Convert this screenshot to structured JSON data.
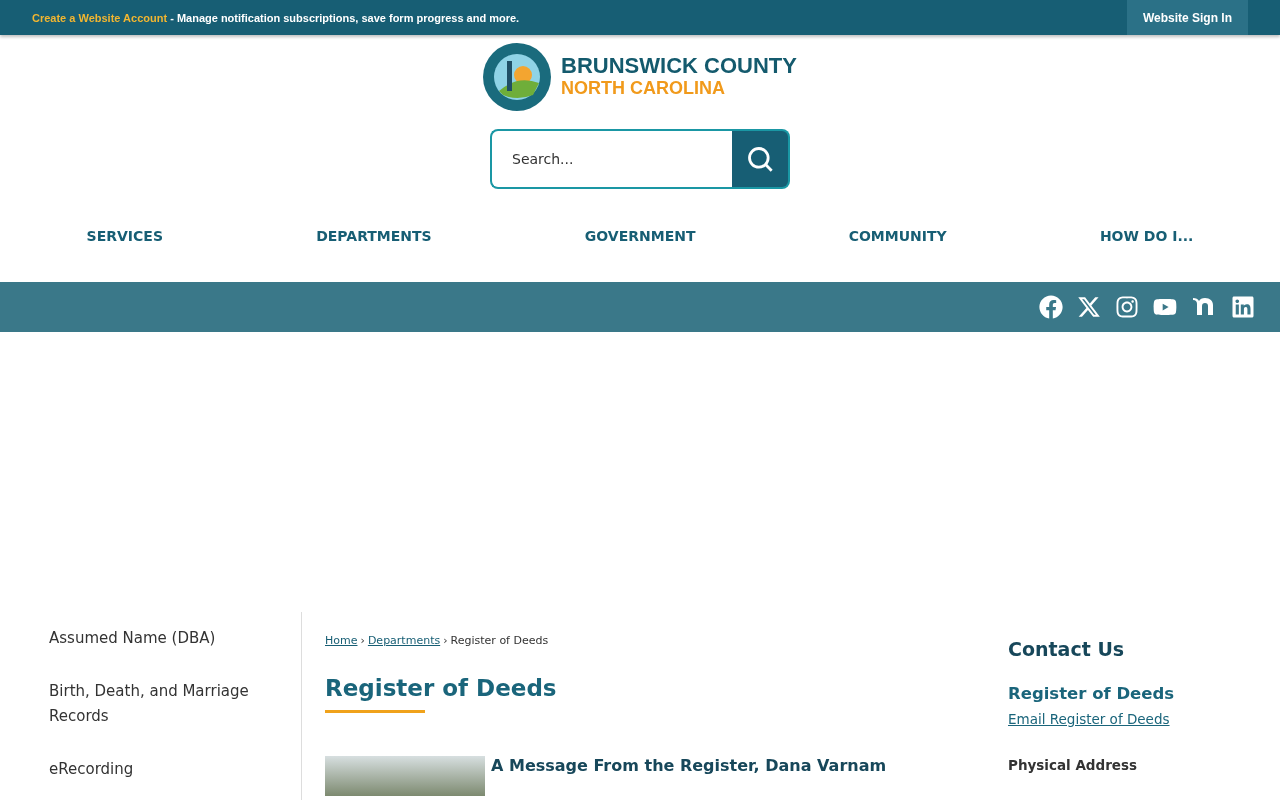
{
  "top_bar": {
    "account_link": "Create a Website Account",
    "account_text": "- Manage notification subscriptions, save form progress and more.",
    "sign_in": "Website Sign In"
  },
  "logo": {
    "line_1": "BRUNSWICK COUNTY",
    "line_2": "NORTH CAROLINA"
  },
  "search": {
    "placeholder": "Search..."
  },
  "nav": [
    "SERVICES",
    "DEPARTMENTS",
    "GOVERNMENT",
    "COMMUNITY",
    "HOW DO I..."
  ],
  "social": [
    {
      "kind": "facebook"
    },
    {
      "kind": "x"
    },
    {
      "kind": "instagram"
    },
    {
      "kind": "youtube"
    },
    {
      "kind": "nextdoor"
    },
    {
      "kind": "linkedin"
    }
  ],
  "sidebar": [
    "Assumed Name (DBA)",
    "Birth, Death, and Marriage Records",
    "eRecording"
  ],
  "breadcrumb": [
    {
      "label": "Home"
    },
    {
      "label": "Departments"
    },
    {
      "label": "Register of Deeds"
    }
  ],
  "breadcrumb_separators": [
    "›",
    "›"
  ],
  "page_title": "Register of Deeds",
  "message_heading": "A Message From the Register, Dana Varnam",
  "contact": {
    "title": "Contact Us",
    "department": "Register of Deeds",
    "email": "Email Register of Deeds",
    "address_label": "Physical Address"
  }
}
